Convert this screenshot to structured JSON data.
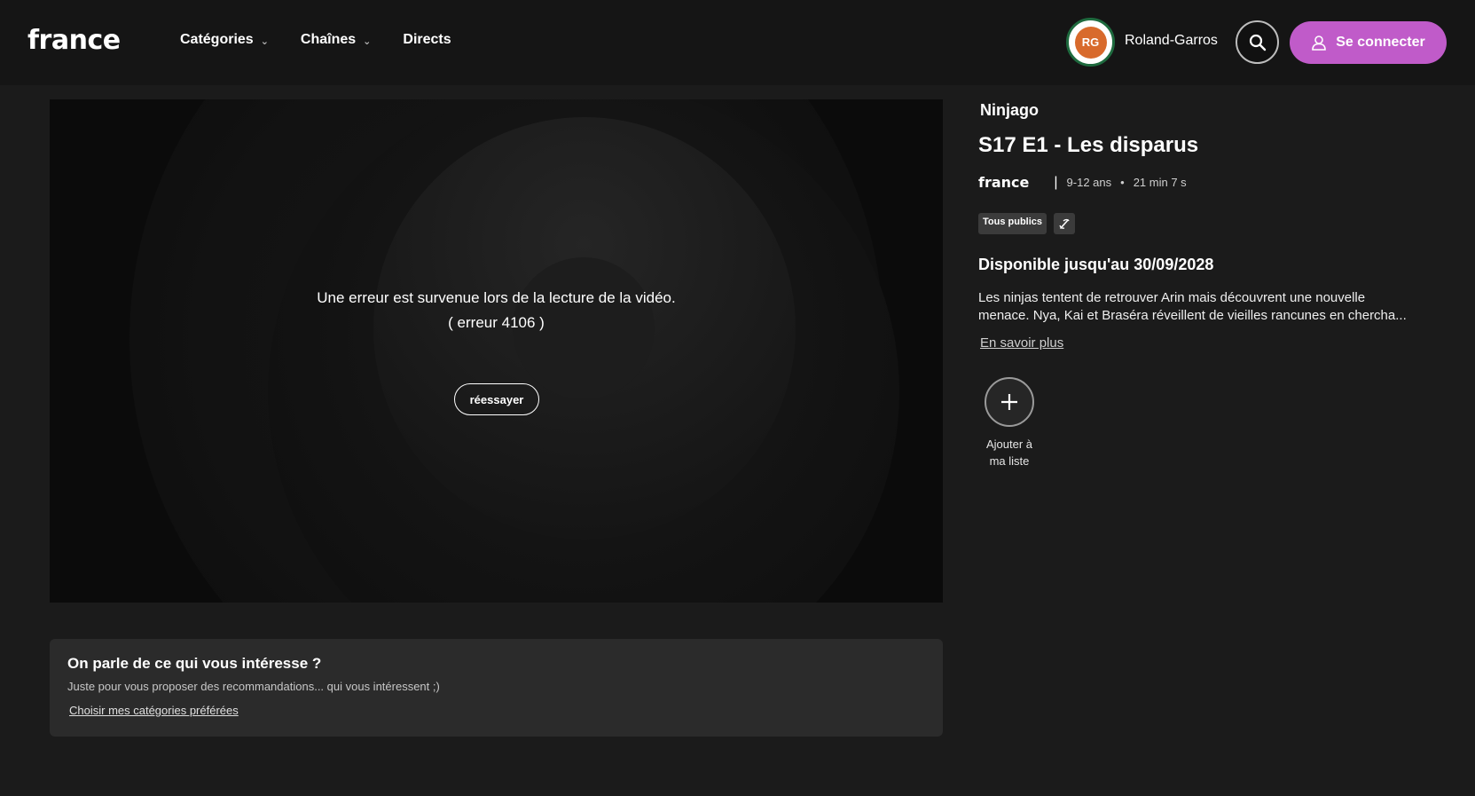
{
  "header": {
    "logo": "france",
    "nav": [
      {
        "label": "Catégories",
        "has_dropdown": true
      },
      {
        "label": "Chaînes",
        "has_dropdown": true
      },
      {
        "label": "Directs",
        "has_dropdown": false
      }
    ],
    "partner_label": "Roland-Garros",
    "partner_logo_text": "RG",
    "search_icon": "search-icon",
    "login_label": "Se connecter",
    "login_icon": "user-icon",
    "accent_color": "#c05bc9"
  },
  "player": {
    "error_line1": "Une erreur est survenue lors de la lecture de la vidéo.",
    "error_line2": "( erreur 4106 )",
    "retry_label": "réessayer"
  },
  "interest": {
    "title": "On parle de ce qui vous intéresse ?",
    "subtitle": "Juste pour vous proposer des recommandations... qui vous intéressent ;)",
    "link": "Choisir mes catégories préférées"
  },
  "episode": {
    "show": "Ninjago",
    "title": "S17 E1 - Les disparus",
    "channel_logo": "france",
    "age": "9-12 ans",
    "duration": "21 min 7 s",
    "badge_public": "Tous publics",
    "badge_icon": "audio-description-icon",
    "availability": "Disponible jusqu'au 30/09/2028",
    "synopsis_line1": "Les ninjas tentent de retrouver Arin mais découvrent une nouvelle",
    "synopsis_line2": "menace. Nya, Kai et Braséra réveillent de vieilles rancunes en chercha...",
    "more_link": "En savoir plus",
    "add_label_line1": "Ajouter à",
    "add_label_line2": "ma liste"
  }
}
